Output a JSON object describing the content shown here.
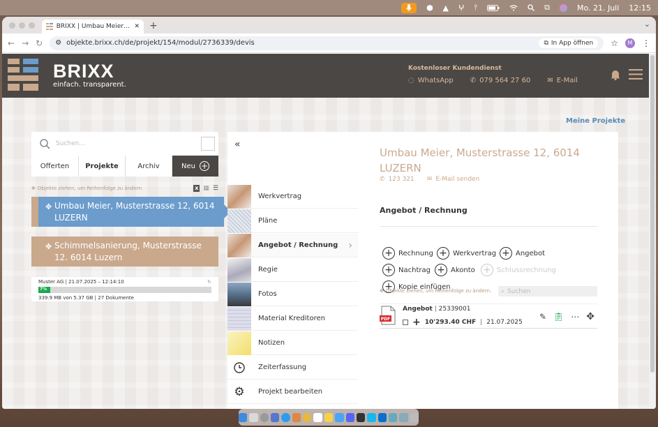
{
  "menubar": {
    "date": "Mo. 21. Juli",
    "time": "12:15"
  },
  "browser": {
    "tab_title": "BRIXX | Umbau Meier, Musterstrasse 12, 6014 LUZERN",
    "url": "objekte.brixx.ch/de/projekt/154/modul/2736339/devis",
    "open_in_app": "In App öffnen",
    "avatar": "M"
  },
  "header": {
    "brand": "BRIXX",
    "tagline": "einfach. transparent.",
    "service_title": "Kostenloser Kundendienst",
    "whatsapp": "WhatsApp",
    "phone": "079 564 27 60",
    "email": "E-Mail"
  },
  "page": {
    "my_projects": "Meine Projekte"
  },
  "left": {
    "search_placeholder": "Suchen...",
    "tabs": [
      "Offerten",
      "Projekte",
      "Archiv",
      "Neu"
    ],
    "active_tab": "Projekte",
    "drag_hint": "Objekte ziehen, um Reihenfolge zu ändern",
    "projects": [
      {
        "name": "Umbau Meier, Musterstrasse 12, 6014 LUZERN",
        "active": true
      },
      {
        "name": "Schimmelsanierung, Musterstrasse 12. 6014 Luzern",
        "active": false
      }
    ],
    "storage": {
      "line1": "Muster AG | 21.07.2025 – 12:14:10",
      "percent": "7%",
      "percent_value": 7,
      "line2": "339.9 MB von 5.37 GB | 27 Dokumente"
    }
  },
  "menu": {
    "items": [
      {
        "label": "Werkvertrag",
        "thumb": "handshake"
      },
      {
        "label": "Pläne",
        "thumb": "plans"
      },
      {
        "label": "Angebot / Rechnung",
        "thumb": "handshake",
        "active": true
      },
      {
        "label": "Regie",
        "thumb": "writing"
      },
      {
        "label": "Fotos",
        "thumb": "photos"
      },
      {
        "label": "Material Kreditoren",
        "thumb": "material"
      },
      {
        "label": "Notizen",
        "thumb": "note"
      },
      {
        "label": "Zeiterfassung",
        "thumb": "clock-icon"
      },
      {
        "label": "Projekt bearbeiten",
        "thumb": "gear-icon"
      }
    ]
  },
  "project": {
    "title": "Umbau Meier, Musterstrasse 12, 6014 LUZERN",
    "phone": "123 321",
    "send_email": "E-Mail senden",
    "section": "Angebot / Rechnung",
    "actions": [
      {
        "label": "Rechnung",
        "enabled": true
      },
      {
        "label": "Werkvertrag",
        "enabled": true
      },
      {
        "label": "Angebot",
        "enabled": true
      },
      {
        "label": "Nachtrag",
        "enabled": true
      },
      {
        "label": "Akonto",
        "enabled": true
      },
      {
        "label": "Schlussrechnung",
        "enabled": false
      },
      {
        "label": "Kopie einfügen",
        "enabled": true
      }
    ],
    "drag_hint": "Objekte ziehen, um Reihenfolge zu ändern.",
    "search_placeholder": "Suchen",
    "document": {
      "type": "Angebot",
      "number": "25339001",
      "amount": "10'293.40 CHF",
      "date": "21.07.2025",
      "icon_label": "PDF"
    }
  },
  "colors": {
    "header_bg": "#4a4744",
    "accent_tan": "#c9a88c",
    "active_blue": "#6b9ccc",
    "link_blue": "#5a8bb5",
    "progress_green": "#1aa84e"
  }
}
